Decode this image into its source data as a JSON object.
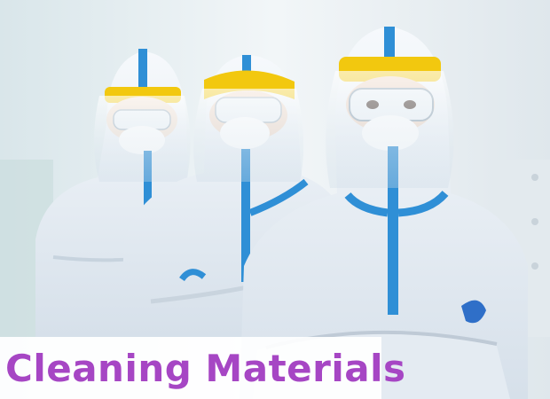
{
  "caption": {
    "text": "Cleaning Materials"
  },
  "colors": {
    "caption_text": "#a646c4",
    "caption_bg": "#ffffff",
    "suit": "#eef3f8",
    "tape": "#2f8fd6",
    "visor": "#f2c80f",
    "background": "#e9eff3"
  },
  "photo": {
    "subject_icon": "medical-worker-in-ppe"
  }
}
